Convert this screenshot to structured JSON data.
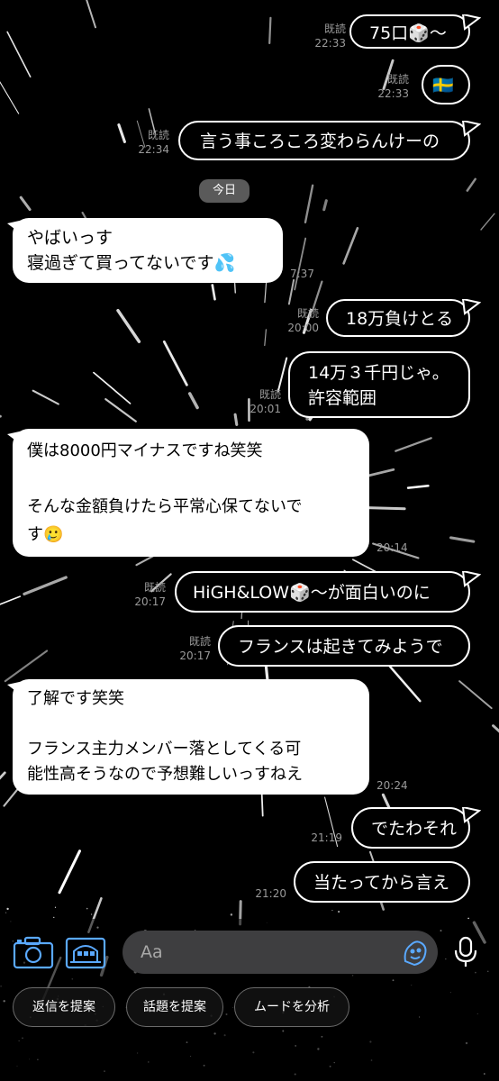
{
  "date_separator": "今日",
  "messages": [
    {
      "side": "out",
      "text": "75口🎲〜",
      "read": "既読",
      "time": "22:33"
    },
    {
      "side": "out",
      "text": "🇸🇪",
      "read": "既読",
      "time": "22:33"
    },
    {
      "side": "out",
      "text": "言う事ころころ変わらんけーの",
      "read": "既読",
      "time": "22:34"
    },
    {
      "side": "in",
      "text": "やばいっす\n寝過ぎて買ってないです💦",
      "time": "7:37"
    },
    {
      "side": "out",
      "text": "18万負けとる",
      "read": "既読",
      "time": "20:00"
    },
    {
      "side": "out",
      "text": "14万３千円じゃ。\n許容範囲",
      "read": "既読",
      "time": "20:01"
    },
    {
      "side": "in",
      "text": "僕は8000円マイナスですね笑笑\n\nそんな金額負けたら平常心保てないで\nす🥲",
      "time": "20:14"
    },
    {
      "side": "out",
      "text": "HiGH&LOW🎲〜が面白いのに",
      "read": "既読",
      "time": "20:17"
    },
    {
      "side": "out",
      "text": "フランスは起きてみようで",
      "read": "既読",
      "time": "20:17"
    },
    {
      "side": "in",
      "text": "了解です笑笑\n\nフランス主力メンバー落としてくる可\n能性高そうなので予想難しいっすねえ",
      "time": "20:24"
    },
    {
      "side": "out",
      "text": "でたわそれ",
      "read": "",
      "time": "21:19"
    },
    {
      "side": "out",
      "text": "当たってから言え",
      "read": "",
      "time": "21:20"
    }
  ],
  "input": {
    "placeholder": "Aa"
  },
  "toolbar": {
    "left_icons": [
      "camera-icon",
      "photo-album-icon"
    ],
    "right_icons": [
      "sticker-icon",
      "microphone-icon"
    ]
  },
  "suggestions": [
    "返信を提案",
    "話題を提案",
    "ムードを分析"
  ],
  "colors": {
    "background": "#000000",
    "incoming_bubble": "#ffffff",
    "outgoing_border": "#ffffff",
    "meta_text": "#9a9a9a",
    "input_bg": "#3e3e40"
  }
}
